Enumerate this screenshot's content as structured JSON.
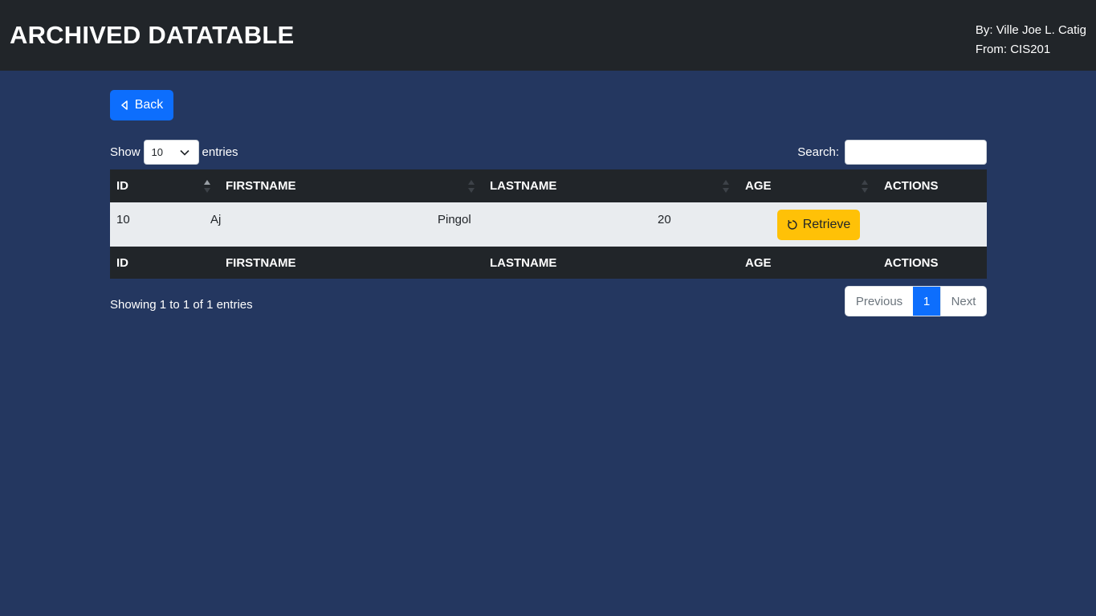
{
  "header": {
    "title": "ARCHIVED DATATABLE",
    "author_line": "By: Ville Joe L. Catig",
    "from_line": "From: CIS201"
  },
  "back_button": {
    "label": "Back",
    "icon": "caret-left-icon",
    "color": "#0d6efd"
  },
  "length": {
    "prefix": "Show",
    "value": "10",
    "suffix": "entries"
  },
  "search": {
    "label": "Search:",
    "value": ""
  },
  "table": {
    "columns": [
      "ID",
      "FIRSTNAME",
      "LASTNAME",
      "AGE",
      "ACTIONS"
    ],
    "rows": [
      {
        "id": "10",
        "firstname": "Aj",
        "lastname": "Pingol",
        "age": "20",
        "action_label": "Retrieve",
        "action_icon": "rotate-icon"
      }
    ],
    "sorted_column": "ID",
    "sort_direction": "ascending"
  },
  "info": "Showing 1 to 1 of 1 entries",
  "pagination": {
    "previous": "Previous",
    "current": "1",
    "next": "Next"
  },
  "colors": {
    "background": "#243760",
    "header": "#212529",
    "retrieve": "#ffc107",
    "row": "#e9ecef"
  }
}
